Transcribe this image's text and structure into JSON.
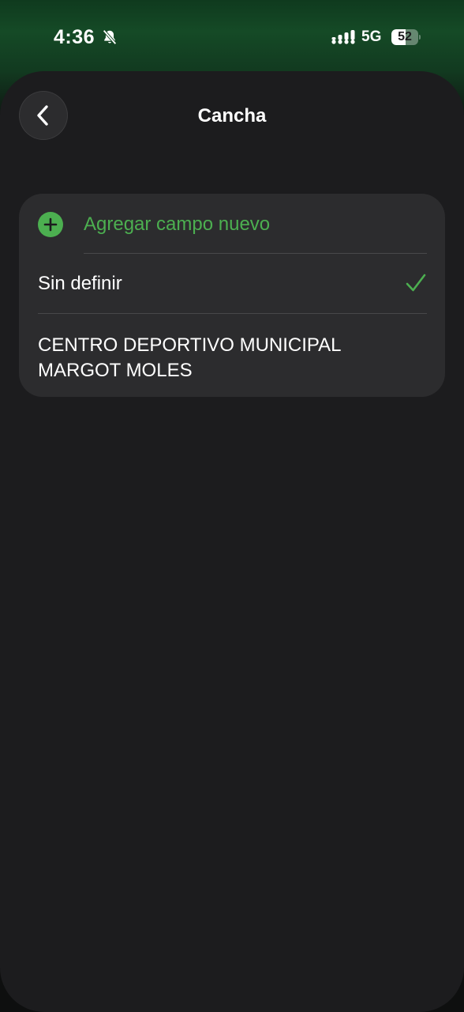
{
  "status_bar": {
    "time": "4:36",
    "network": "5G",
    "battery_level": "52",
    "battery_fraction": 0.52,
    "icons": [
      "bell-slash-icon",
      "signal-icon"
    ]
  },
  "nav": {
    "title": "Cancha",
    "back_icon": "chevron-left-icon"
  },
  "list": {
    "add_label": "Agregar campo nuevo",
    "items": [
      {
        "label": "Sin definir",
        "selected": true
      },
      {
        "label": "CENTRO DEPORTIVO MUNICIPAL MARGOT MOLES",
        "selected": false
      }
    ]
  },
  "colors": {
    "accent": "#4caf50",
    "background": "#1c1c1e",
    "card": "#2c2c2e",
    "header_green": "#154a26"
  }
}
